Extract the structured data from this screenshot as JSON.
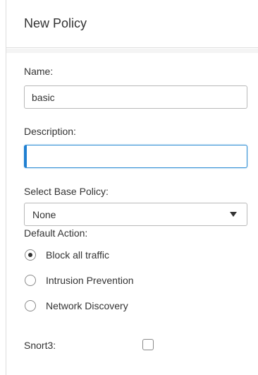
{
  "header": {
    "title": "New Policy"
  },
  "form": {
    "name": {
      "label": "Name:",
      "value": "basic"
    },
    "description": {
      "label": "Description:",
      "value": ""
    },
    "base_policy": {
      "label": "Select Base Policy:",
      "selected": "None"
    },
    "default_action": {
      "label": "Default Action:",
      "options": [
        {
          "label": "Block all traffic",
          "checked": true
        },
        {
          "label": "Intrusion Prevention",
          "checked": false
        },
        {
          "label": "Network Discovery",
          "checked": false
        }
      ]
    },
    "snort3": {
      "label": "Snort3:",
      "checked": false
    }
  },
  "colors": {
    "focus": "#2a8bd3",
    "border": "#b9b9b9",
    "text": "#333333"
  }
}
